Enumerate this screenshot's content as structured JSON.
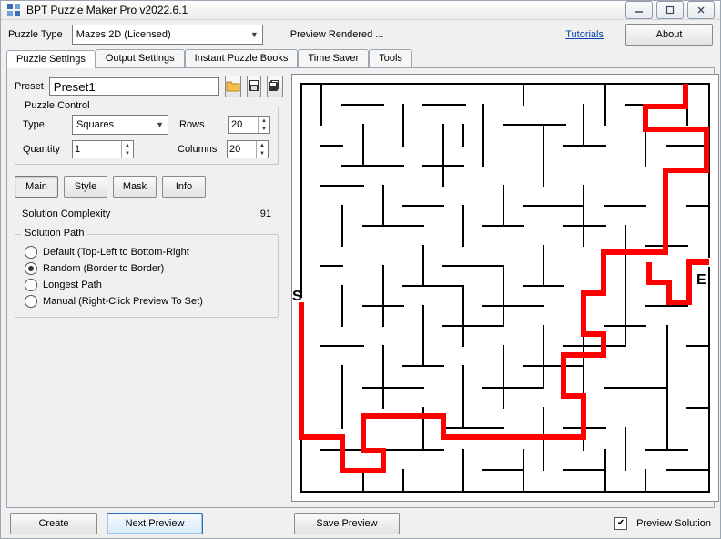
{
  "window": {
    "title": "BPT Puzzle Maker Pro v2022.6.1"
  },
  "topbar": {
    "puzzle_type_label": "Puzzle Type",
    "puzzle_type_value": "Mazes 2D (Licensed)",
    "status": "Preview Rendered ...",
    "tutorials": "Tutorials",
    "about": "About"
  },
  "tabs": {
    "items": [
      {
        "label": "Puzzle Settings",
        "active": true
      },
      {
        "label": "Output Settings"
      },
      {
        "label": "Instant Puzzle Books"
      },
      {
        "label": "Time Saver"
      },
      {
        "label": "Tools"
      }
    ]
  },
  "preset": {
    "label": "Preset",
    "value": "Preset1"
  },
  "control": {
    "legend": "Puzzle Control",
    "type_label": "Type",
    "type_value": "Squares",
    "rows_label": "Rows",
    "rows_value": "20",
    "quantity_label": "Quantity",
    "quantity_value": "1",
    "cols_label": "Columns",
    "cols_value": "20"
  },
  "subtabs": {
    "items": [
      {
        "label": "Main",
        "active": true
      },
      {
        "label": "Style"
      },
      {
        "label": "Mask"
      },
      {
        "label": "Info"
      }
    ]
  },
  "complexity": {
    "label": "Solution Complexity",
    "value": "91"
  },
  "path": {
    "legend": "Solution Path",
    "options": [
      {
        "label": "Default (Top-Left to Bottom-Right",
        "checked": false
      },
      {
        "label": "Random (Border to Border)",
        "checked": true
      },
      {
        "label": "Longest Path",
        "checked": false
      },
      {
        "label": "Manual (Right-Click Preview To Set)",
        "checked": false
      }
    ]
  },
  "maze": {
    "start_label": "S",
    "end_label": "E"
  },
  "footer": {
    "create": "Create",
    "next": "Next Preview",
    "save": "Save Preview",
    "preview_solution_label": "Preview Solution",
    "preview_solution_checked": true
  }
}
